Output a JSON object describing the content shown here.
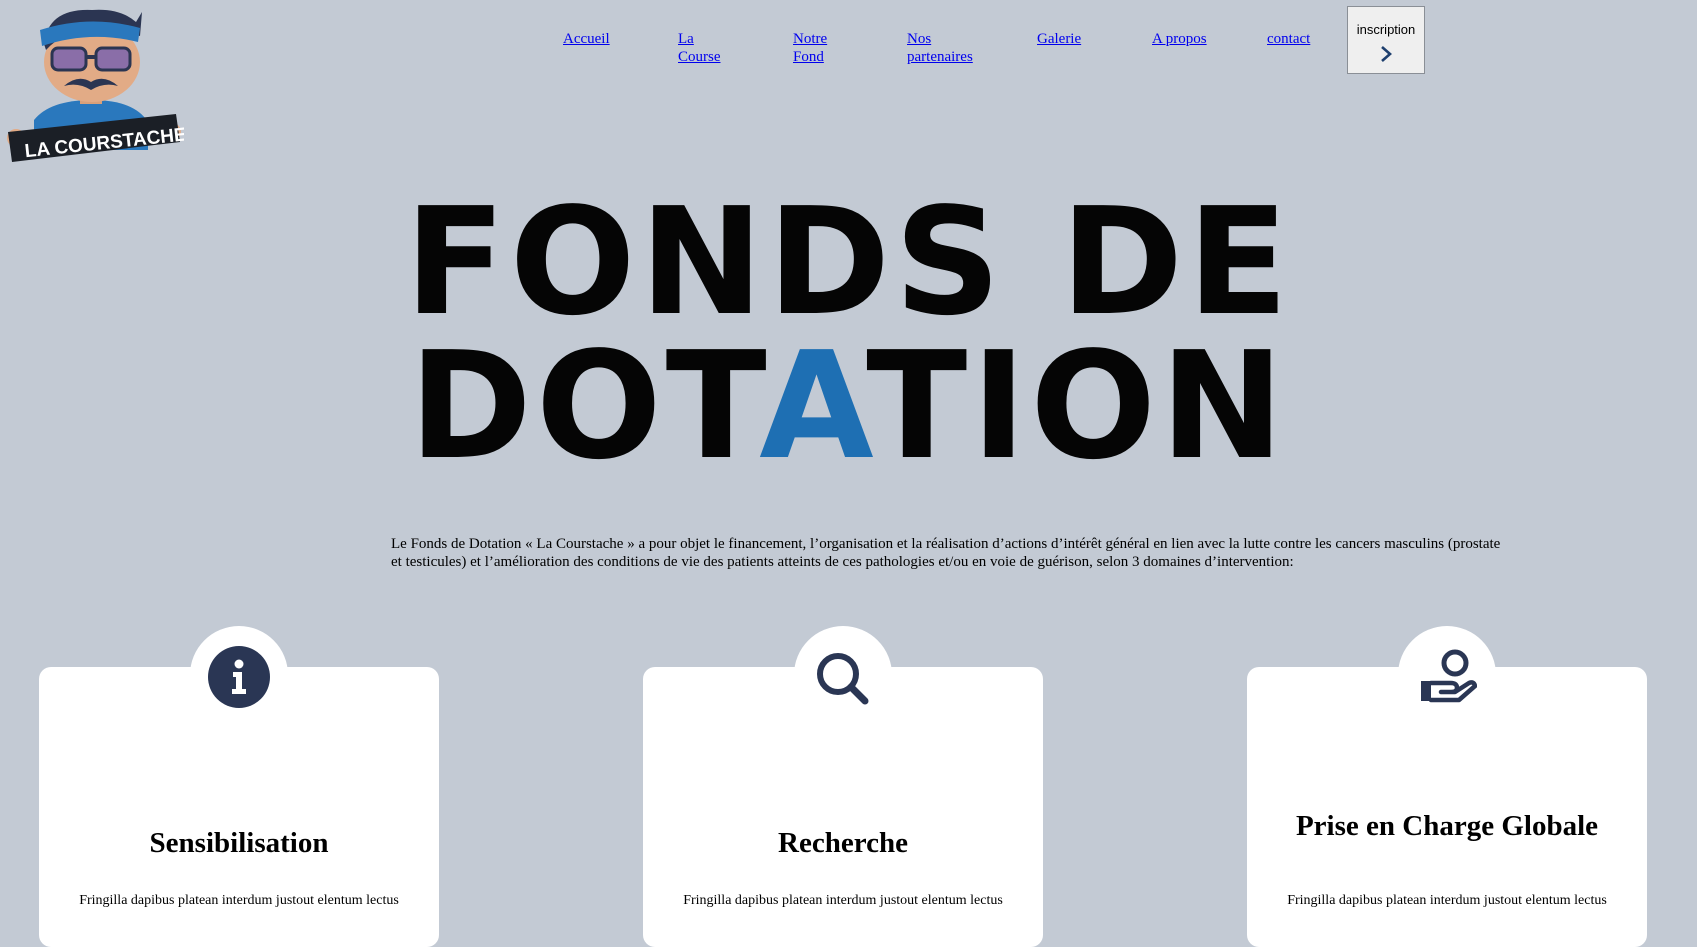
{
  "logo": {
    "text": "LA COURSTACHE"
  },
  "nav": {
    "items": [
      {
        "label": "Accueil"
      },
      {
        "label": "La Course"
      },
      {
        "label": "Notre Fond"
      },
      {
        "label": "Nos partenaires"
      },
      {
        "label": "Galerie"
      },
      {
        "label": "A propos"
      },
      {
        "label": "contact"
      }
    ],
    "cta": {
      "label": "inscription",
      "icon": "chevron-right-icon"
    }
  },
  "hero": {
    "line1": "FONDS DE",
    "line2_pre": "DOT",
    "line2_accent": "A",
    "line2_post": "TION",
    "accent_color": "#1e6fb3"
  },
  "intro": {
    "text": "Le Fonds de Dotation « La Courstache » a pour objet le financement, l’organisation et la réalisation d’actions d’intérêt général en lien avec la lutte contre les cancers masculins (prostate et testicules) et l’amélioration des conditions de vie des patients atteints de ces pathologies et/ou en voie de guérison, selon 3 domaines d’intervention:"
  },
  "cards": [
    {
      "title": "Sensibilisation",
      "text": "Fringilla dapibus platean interdum justout elentum lectus",
      "icon": "info-icon"
    },
    {
      "title": "Recherche",
      "text": "Fringilla dapibus platean interdum justout elentum lectus",
      "icon": "search-icon"
    },
    {
      "title": "Prise en Charge Globale",
      "text": "Fringilla dapibus platean interdum justout elentum lectus",
      "icon": "helping-hand-icon"
    }
  ],
  "colors": {
    "background": "#c3cad4",
    "icon_navy": "#2a3654",
    "accent": "#1e6fb3"
  }
}
